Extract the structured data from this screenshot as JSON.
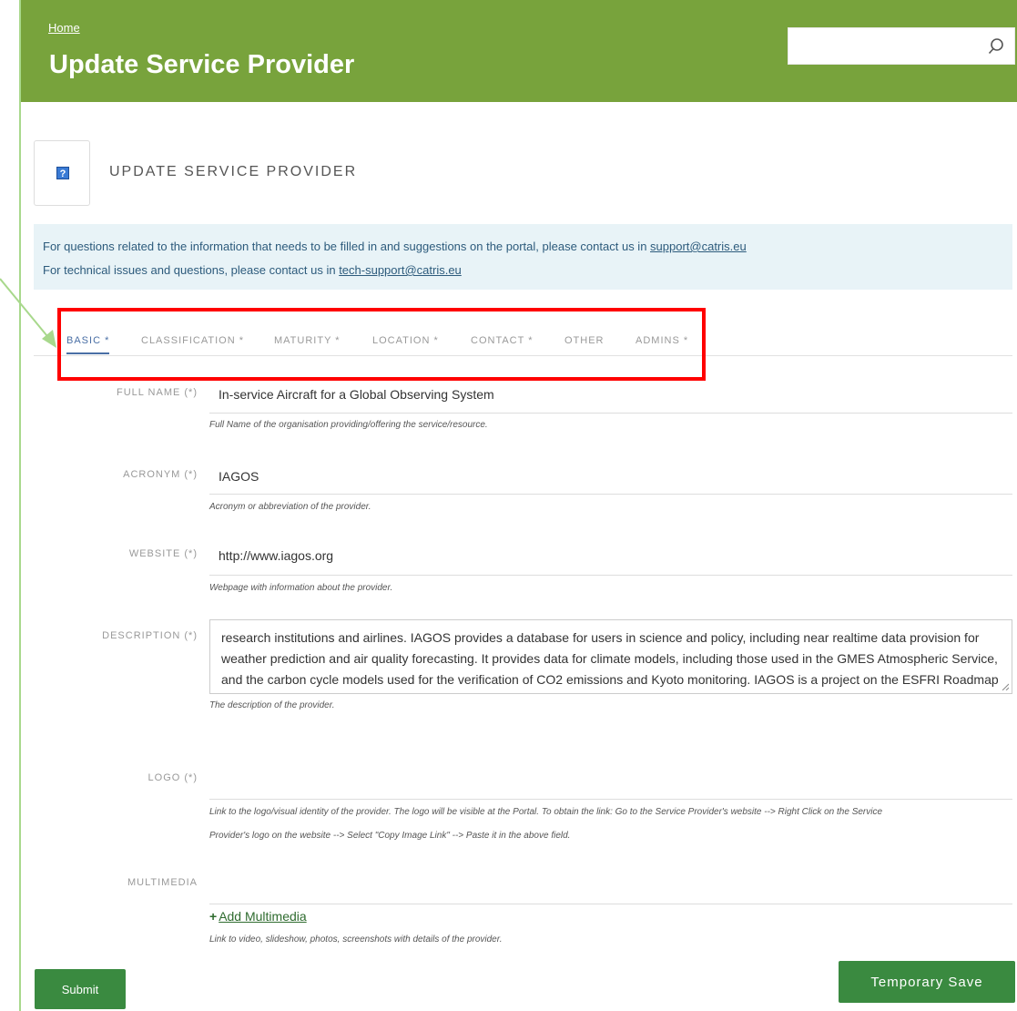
{
  "header": {
    "breadcrumb_home": "Home",
    "title": "Update Service Provider",
    "search_placeholder": ""
  },
  "section": {
    "icon": "help-icon",
    "icon_glyph": "?",
    "title": "UPDATE SERVICE PROVIDER"
  },
  "info": {
    "line1_text": "For questions related to the information that needs to be filled in and suggestions on the portal, please contact us in ",
    "line1_link": "support@catris.eu",
    "line2_text": "For technical issues and questions, please contact us in ",
    "line2_link": "tech-support@catris.eu"
  },
  "tabs": [
    {
      "label": "BASIC *",
      "active": true
    },
    {
      "label": "CLASSIFICATION *",
      "active": false
    },
    {
      "label": "MATURITY *",
      "active": false
    },
    {
      "label": "LOCATION *",
      "active": false
    },
    {
      "label": "CONTACT *",
      "active": false
    },
    {
      "label": "OTHER",
      "active": false
    },
    {
      "label": "ADMINS *",
      "active": false
    }
  ],
  "fields": {
    "full_name": {
      "label": "FULL NAME (*)",
      "value": "In-service Aircraft for a Global Observing System",
      "hint": "Full Name of the organisation providing/offering the service/resource."
    },
    "acronym": {
      "label": "ACRONYM (*)",
      "value": "IAGOS",
      "hint": "Acronym or abbreviation of the provider."
    },
    "website": {
      "label": "WEBSITE (*)",
      "value": "http://www.iagos.org",
      "hint": "Webpage with information about the provider."
    },
    "description": {
      "label": "DESCRIPTION (*)",
      "value": "research institutions and airlines. IAGOS provides a database for users in science and policy, including near realtime data provision for weather prediction and air quality forecasting. It provides data for climate models, including those used in the GMES Atmospheric Service, and the carbon cycle models used for the verification of CO2 emissions and Kyoto monitoring. IAGOS is a project on the ESFRI Roadmap of Research Infrastructures (RIs) of pan-European interest.",
      "hint": "The description of the provider."
    },
    "logo": {
      "label": "LOGO (*)",
      "value": "",
      "hint_line1": "Link to the logo/visual identity of the provider. The logo will be visible at the Portal. To obtain the link: Go to the Service Provider's website --> Right Click on the Service",
      "hint_line2": "Provider's logo on the website --> Select \"Copy Image Link\" --> Paste it in the above field."
    },
    "multimedia": {
      "label": "MULTIMEDIA",
      "add_label": "Add Multimedia",
      "add_icon": "plus-icon",
      "hint": "Link to video, slideshow, photos, screenshots with details of the provider."
    }
  },
  "buttons": {
    "submit": "Submit",
    "temporary_save": "Temporary Save"
  },
  "colors": {
    "header_green": "#78a33c",
    "button_green": "#3a8a40",
    "info_bg": "#e8f3f7",
    "highlight_red": "#ff0000",
    "active_tab": "#4a6fa5"
  }
}
